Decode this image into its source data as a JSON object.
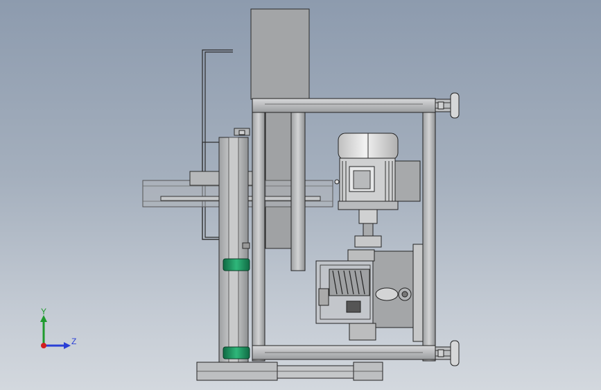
{
  "viewport": {
    "background_top": "#8d9bae",
    "background_bottom": "#d3d8de"
  },
  "model": {
    "frame_color": "#b7b9bb",
    "frame_edge": "#2b2b2b",
    "motor_fin_color": "#c8c8c8",
    "bracket_color": "#1c8a5a"
  },
  "triad": {
    "y_label": "Y",
    "z_label": "Z",
    "y_axis_color": "#1f9b2e",
    "z_axis_color": "#2a3fd6",
    "x_axis_color": "#d11f1f"
  }
}
